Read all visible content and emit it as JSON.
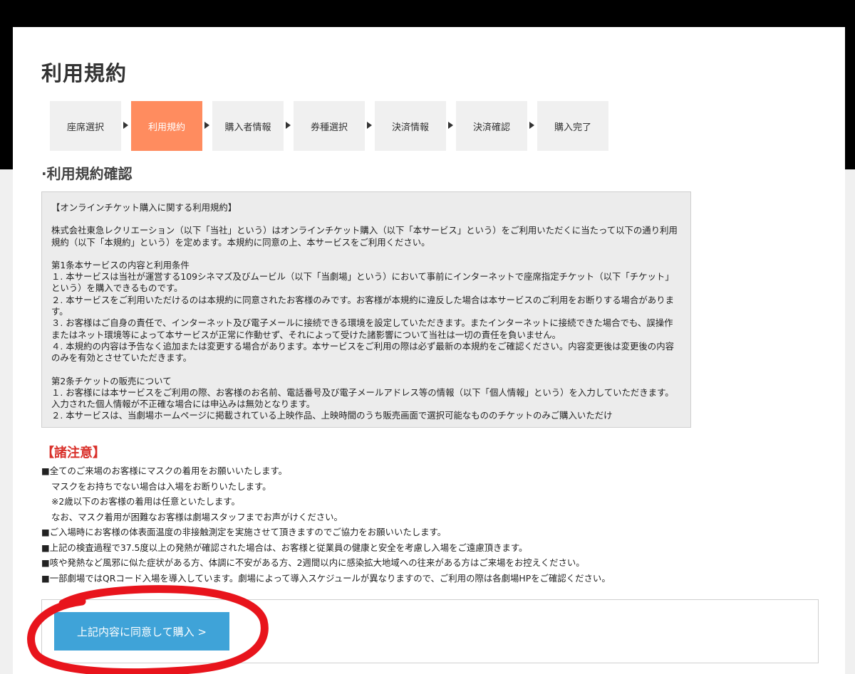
{
  "page_title": "利用規約",
  "steps": [
    {
      "label": "座席選択",
      "active": false
    },
    {
      "label": "利用規約",
      "active": true
    },
    {
      "label": "購入者情報",
      "active": false
    },
    {
      "label": "券種選択",
      "active": false
    },
    {
      "label": "決済情報",
      "active": false
    },
    {
      "label": "決済確認",
      "active": false
    },
    {
      "label": "購入完了",
      "active": false
    }
  ],
  "section_title": "·利用規約確認",
  "terms": {
    "heading": "【オンラインチケット購入に関する利用規約】",
    "intro": "株式会社東急レクリエーション（以下「当社」という）はオンラインチケット購入（以下「本サービス」という）をご利用いただくに当たって以下の通り利用規約（以下「本規約」という）を定めます。本規約に同意の上、本サービスをご利用ください。",
    "art1_title": "第1条本サービスの内容と利用条件",
    "art1_1": "１. 本サービスは当社が運営する109シネマズ及びムービル（以下「当劇場」という）において事前にインターネットで座席指定チケット（以下「チケット」という）を購入できるものです。",
    "art1_2": "２. 本サービスをご利用いただけるのは本規約に同意されたお客様のみです。お客様が本規約に違反した場合は本サービスのご利用をお断りする場合があります。",
    "art1_3": "３. お客様はご自身の責任で、インターネット及び電子メールに接続できる環境を設定していただきます。またインターネットに接続できた場合でも、誤操作またはネット環境等によって本サービスが正常に作動せず、それによって受けた諸影響について当社は一切の責任を負いません。",
    "art1_4": "４. 本規約の内容は予告なく追加または変更する場合があります。本サービスをご利用の際は必ず最新の本規約をご確認ください。内容変更後は変更後の内容のみを有効とさせていただきます。",
    "art2_title": "第2条チケットの販売について",
    "art2_1": "１. お客様には本サービスをご利用の際、お客様のお名前、電話番号及び電子メールアドレス等の情報（以下「個人情報」という）を入力していただきます。入力された個人情報が不正確な場合には申込みは無効となります。",
    "art2_2": "２. 本サービスは、当劇場ホームページに掲載されている上映作品、上映時間のうち販売画面で選択可能なもののチケットのみご購入いただけ"
  },
  "notice_title": "【諸注意】",
  "notes": [
    {
      "text": "■全てのご来場のお客様にマスクの着用をお願いいたします。",
      "indent": false
    },
    {
      "text": "マスクをお持ちでない場合は入場をお断りいたします。",
      "indent": true
    },
    {
      "text": "※2歳以下のお客様の着用は任意といたします。",
      "indent": true
    },
    {
      "text": "なお、マスク着用が困難なお客様は劇場スタッフまでお声がけください。",
      "indent": true
    },
    {
      "text": "■ご入場時にお客様の体表面温度の非接触測定を実施させて頂きますのでご協力をお願いいたします。",
      "indent": false
    },
    {
      "text": "■上記の検査過程で37.5度以上の発熱が確認された場合は、お客様と従業員の健康と安全を考慮し入場をご遠慮頂きます。",
      "indent": false
    },
    {
      "text": "■咳や発熱など風邪に似た症状がある方、体調に不安がある方、2週間以内に感染拡大地域への往来がある方はご来場をお控えください。",
      "indent": false
    },
    {
      "text": "■一部劇場ではQRコード入場を導入しています。劇場によって導入スケジュールが異なりますので、ご利用の際は各劇場HPをご確認ください。",
      "indent": false
    }
  ],
  "cta_label": "上記内容に同意して購入 >",
  "colors": {
    "active_step": "#ff8c5f",
    "cta": "#3fa3d8",
    "notice": "#d9302a",
    "annotation": "#e8141c"
  }
}
